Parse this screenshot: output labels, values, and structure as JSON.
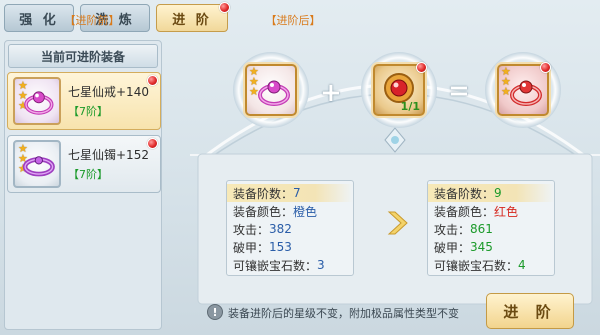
{
  "tabs": [
    {
      "label": "强 化"
    },
    {
      "label": "洗 炼"
    },
    {
      "label": "进 阶"
    }
  ],
  "left_panel": {
    "title": "当前可进阶装备",
    "items": [
      {
        "name": "七星仙戒+140",
        "grade": "【7阶】",
        "stars": 3,
        "icon": "ring-icon",
        "selected": true
      },
      {
        "name": "七星仙镯+152",
        "grade": "【7阶】",
        "stars": 3,
        "icon": "bracelet-icon",
        "selected": false
      }
    ]
  },
  "material": {
    "count": "1/1"
  },
  "compare": {
    "before_title": "【进阶前】",
    "after_title": "【进阶后】",
    "before": {
      "tier": {
        "label": "装备阶数：",
        "value": "7"
      },
      "color": {
        "label": "装备颜色：",
        "value": "橙色"
      },
      "attack": {
        "label": "攻击：",
        "value": "382"
      },
      "pierce": {
        "label": "破甲：",
        "value": "153"
      },
      "gem_slots": {
        "label": "可镶嵌宝石数：",
        "value": "3"
      }
    },
    "after": {
      "tier": {
        "label": "装备阶数：",
        "value": "9"
      },
      "color": {
        "label": "装备颜色：",
        "value": "红色"
      },
      "attack": {
        "label": "攻击：",
        "value": "861"
      },
      "pierce": {
        "label": "破甲：",
        "value": "345"
      },
      "gem_slots": {
        "label": "可镶嵌宝石数：",
        "value": "4"
      }
    }
  },
  "note": "装备进阶后的星级不变，附加极品属性类型不变",
  "advance_button": "进 阶",
  "colors": {
    "accent_gold": "#f2d48d",
    "green": "#1b9a2a",
    "red": "#d6281f",
    "orange": "#d97a1a"
  }
}
